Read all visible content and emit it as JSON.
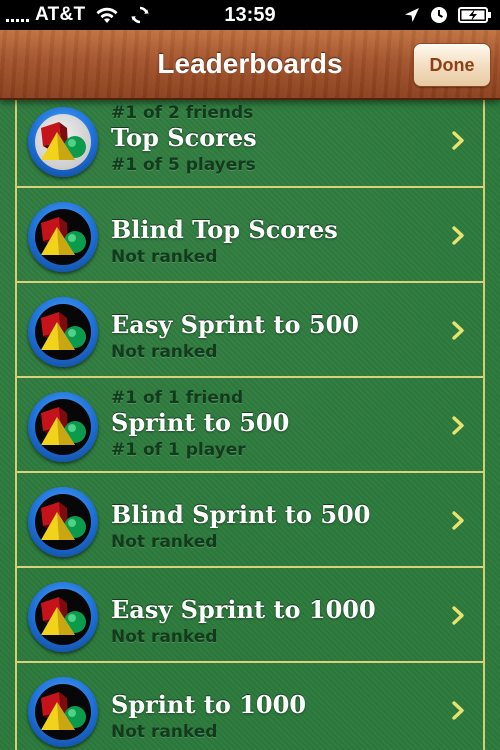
{
  "status_bar": {
    "carrier": "AT&T",
    "time": "13:59"
  },
  "nav": {
    "title": "Leaderboards",
    "done_label": "Done"
  },
  "leaderboards": [
    {
      "friends_rank": "#1 of 2 friends",
      "title": "Top Scores",
      "players_rank": "#1 of 5 players",
      "icon": "game-ball-shapes-icon-light"
    },
    {
      "friends_rank": "",
      "title": "Blind Top Scores",
      "players_rank": "Not ranked",
      "icon": "game-ball-shapes-icon"
    },
    {
      "friends_rank": "",
      "title": "Easy Sprint to 500",
      "players_rank": "Not ranked",
      "icon": "game-ball-shapes-icon"
    },
    {
      "friends_rank": "#1 of 1 friend",
      "title": "Sprint to 500",
      "players_rank": "#1 of 1 player",
      "icon": "game-ball-shapes-icon"
    },
    {
      "friends_rank": "",
      "title": "Blind Sprint to 500",
      "players_rank": "Not ranked",
      "icon": "game-ball-shapes-icon"
    },
    {
      "friends_rank": "",
      "title": "Easy Sprint to 1000",
      "players_rank": "Not ranked",
      "icon": "game-ball-shapes-icon"
    },
    {
      "friends_rank": "",
      "title": "Sprint to 1000",
      "players_rank": "Not ranked",
      "icon": "game-ball-shapes-icon"
    }
  ]
}
